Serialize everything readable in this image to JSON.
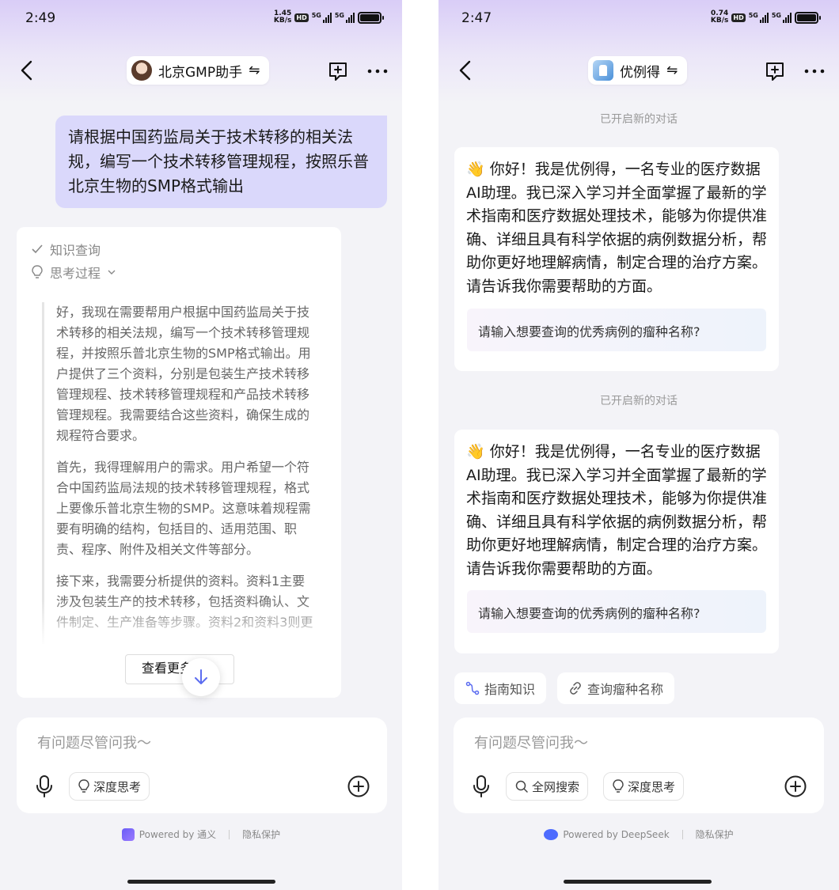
{
  "left": {
    "status": {
      "time": "2:49",
      "speed_value": "1.45",
      "speed_unit": "KB/s"
    },
    "header": {
      "title": "北京GMP助手",
      "switch_glyph": "⇋"
    },
    "user_message": "请根据中国药监局关于技术转移的相关法规，编写一个技术转移管理规程，按照乐普北京生物的SMP格式输出",
    "reply": {
      "knowledge_label": "知识查询",
      "thinking_label": "思考过程",
      "thinking_paragraphs": [
        "好，我现在需要帮用户根据中国药监局关于技术转移的相关法规，编写一个技术转移管理规程，并按照乐普北京生物的SMP格式输出。用户提供了三个资料，分别是包装生产技术转移管理规程、技术转移管理规程和产品技术转移管理规程。我需要结合这些资料，确保生成的规程符合要求。",
        "首先，我得理解用户的需求。用户希望一个符合中国药监局法规的技术转移管理规程，格式上要像乐普北京生物的SMP。这意味着规程需要有明确的结构，包括目的、适用范围、职责、程序、附件及相关文件等部分。",
        "接下来，我需要分析提供的资料。资料1主要涉及包装生产的技术转移，包括资料确认、文件制定、生产准备等步骤。资料2和资料3则更"
      ],
      "more_label": "查看更多"
    },
    "input": {
      "placeholder": "有问题尽管问我～",
      "deep_think_label": "深度思考"
    },
    "footer": {
      "powered_by": "Powered by 通义",
      "privacy": "隐私保护"
    }
  },
  "right": {
    "status": {
      "time": "2:47",
      "speed_value": "0.74",
      "speed_unit": "KB/s"
    },
    "header": {
      "title": "优例得",
      "switch_glyph": "⇋"
    },
    "system_note": "已开启新的对话",
    "greeting": "👋 你好！我是优例得，一名专业的医疗数据AI助理。我已深入学习并全面掌握了最新的学术指南和医疗数据处理技术，能够为你提供准确、详细且具有科学依据的病例数据分析，帮助你更好地理解病情，制定合理的治疗方案。请告诉我你需要帮助的方面。",
    "prompt_suggestion": "请输入想要查询的优秀病例的瘤种名称?",
    "suggestions": [
      "指南知识",
      "查询瘤种名称"
    ],
    "input": {
      "placeholder": "有问题尽管问我～",
      "web_search_label": "全网搜索",
      "deep_think_label": "深度思考"
    },
    "footer": {
      "powered_by": "Powered by DeepSeek",
      "privacy": "隐私保护"
    }
  },
  "status_icons": {
    "hd": "HD",
    "network": "5G"
  },
  "colors": {
    "user_bubble": "#dad8fb",
    "accent": "#5b6cf0"
  }
}
